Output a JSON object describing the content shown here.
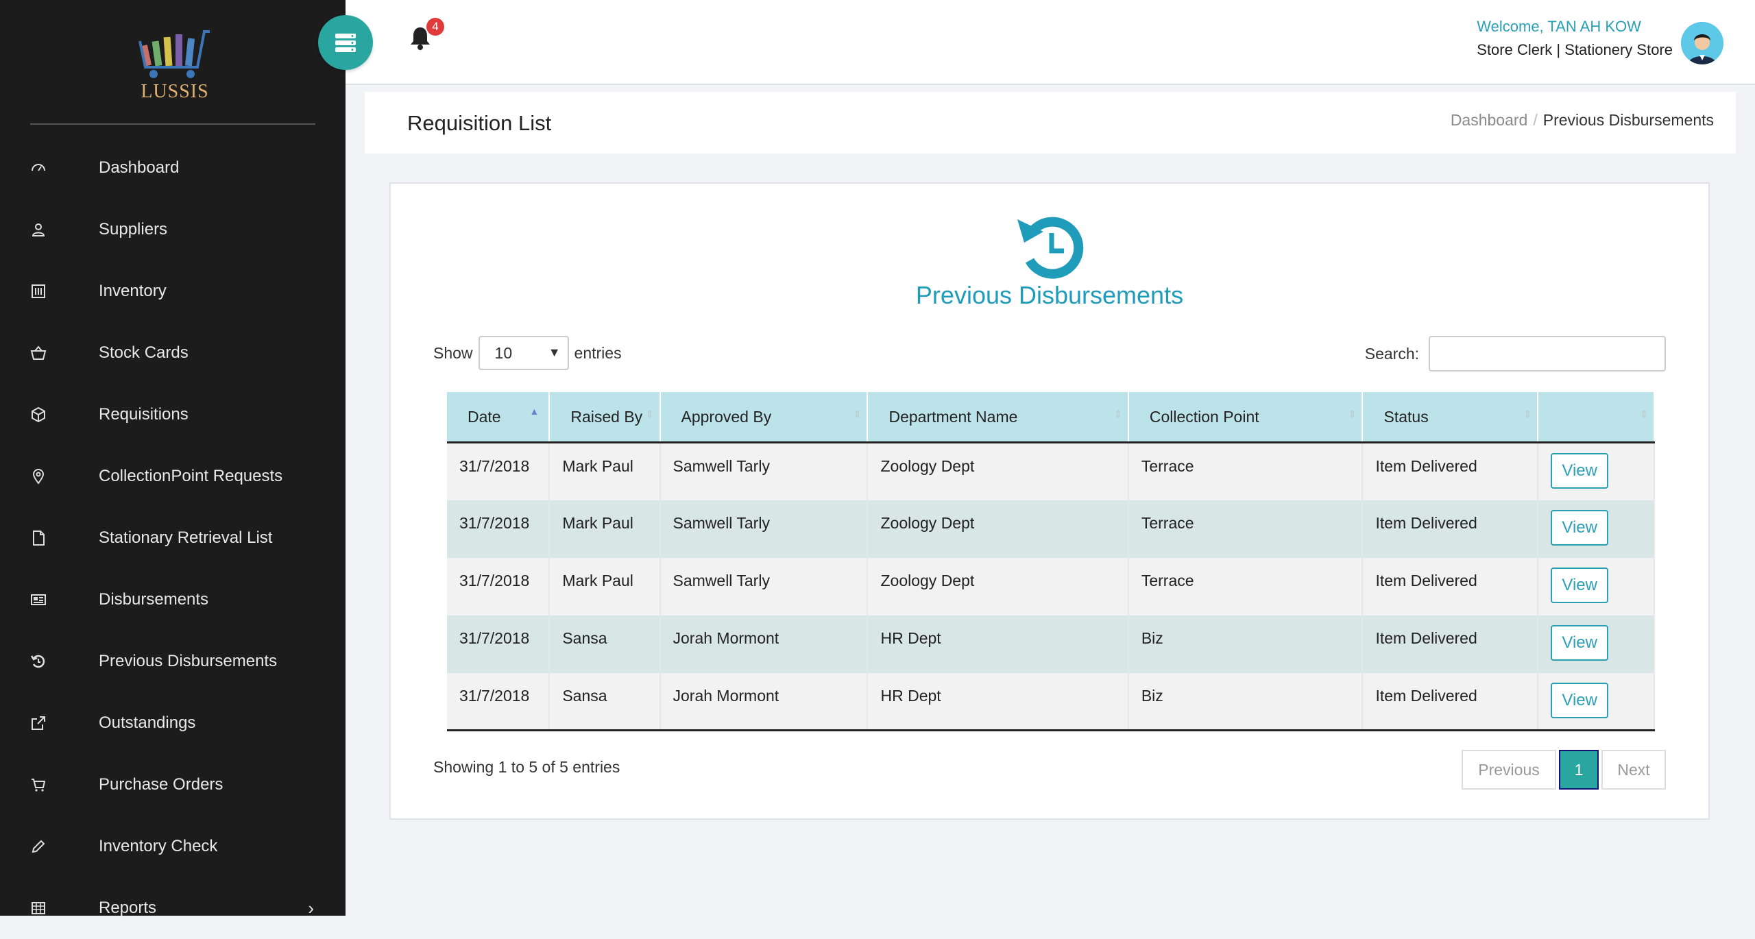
{
  "app": {
    "name": "LUSSIS"
  },
  "sidebar": {
    "items": [
      {
        "label": "Dashboard",
        "icon": "dashboard-icon"
      },
      {
        "label": "Suppliers",
        "icon": "user-icon"
      },
      {
        "label": "Inventory",
        "icon": "inventory-icon"
      },
      {
        "label": "Stock Cards",
        "icon": "basket-icon"
      },
      {
        "label": "Requisitions",
        "icon": "box-icon"
      },
      {
        "label": "CollectionPoint Requests",
        "icon": "map-pin-icon"
      },
      {
        "label": "Stationary Retrieval List",
        "icon": "pdf-icon"
      },
      {
        "label": "Disbursements",
        "icon": "newspaper-icon"
      },
      {
        "label": "Previous Disbursements",
        "icon": "history-icon"
      },
      {
        "label": "Outstandings",
        "icon": "external-link-icon"
      },
      {
        "label": "Purchase Orders",
        "icon": "cart-icon"
      },
      {
        "label": "Inventory Check",
        "icon": "pencil-icon"
      },
      {
        "label": "Reports",
        "icon": "table-icon"
      }
    ]
  },
  "header": {
    "notification_count": "4",
    "welcome": "Welcome, TAN AH KOW",
    "role": "Store Clerk | Stationery Store"
  },
  "page": {
    "title": "Requisition List",
    "breadcrumb": {
      "home": "Dashboard",
      "current": "Previous Disbursements"
    }
  },
  "card": {
    "title": "Previous Disbursements"
  },
  "table_controls": {
    "show_label": "Show",
    "page_size": "10",
    "entries_label": "entries",
    "search_label": "Search:",
    "search_value": ""
  },
  "table": {
    "columns": [
      "Date",
      "Raised By",
      "Approved By",
      "Department Name",
      "Collection Point",
      "Status",
      ""
    ],
    "rows": [
      {
        "date": "31/7/2018",
        "raised_by": "Mark Paul",
        "approved_by": "Samwell Tarly",
        "department": "Zoology Dept",
        "collection_point": "Terrace",
        "status": "Item Delivered",
        "action": "View"
      },
      {
        "date": "31/7/2018",
        "raised_by": "Mark Paul",
        "approved_by": "Samwell Tarly",
        "department": "Zoology Dept",
        "collection_point": "Terrace",
        "status": "Item Delivered",
        "action": "View"
      },
      {
        "date": "31/7/2018",
        "raised_by": "Mark Paul",
        "approved_by": "Samwell Tarly",
        "department": "Zoology Dept",
        "collection_point": "Terrace",
        "status": "Item Delivered",
        "action": "View"
      },
      {
        "date": "31/7/2018",
        "raised_by": "Sansa",
        "approved_by": "Jorah Mormont",
        "department": "HR Dept",
        "collection_point": "Biz",
        "status": "Item Delivered",
        "action": "View"
      },
      {
        "date": "31/7/2018",
        "raised_by": "Sansa",
        "approved_by": "Jorah Mormont",
        "department": "HR Dept",
        "collection_point": "Biz",
        "status": "Item Delivered",
        "action": "View"
      }
    ],
    "info": "Showing 1 to 5 of 5 entries"
  },
  "pagination": {
    "previous": "Previous",
    "current": "1",
    "next": "Next"
  },
  "colors": {
    "accent": "#2aa6a0",
    "title": "#1e9cba",
    "sidebar": "#1c1c1c",
    "header_row": "#bce3ea",
    "badge": "#e03a3a"
  }
}
